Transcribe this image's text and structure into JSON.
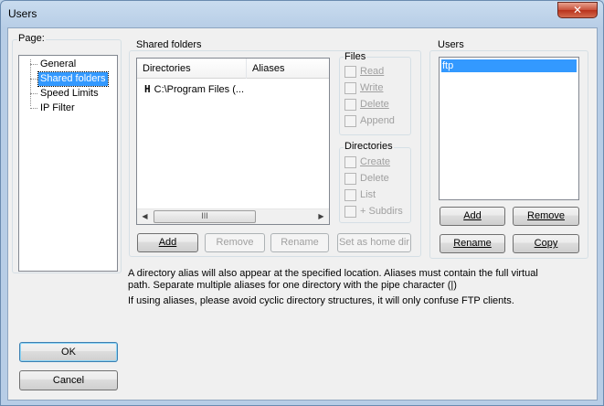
{
  "window": {
    "title": "Users",
    "close_glyph": "✕"
  },
  "page_panel": {
    "label": "Page:",
    "items": [
      "General",
      "Shared folders",
      "Speed Limits",
      "IP Filter"
    ],
    "selected": "Shared folders"
  },
  "shared_folders": {
    "label": "Shared folders",
    "columns": [
      "Directories",
      "Aliases"
    ],
    "rows": [
      {
        "marker": "H",
        "directory": "C:\\Program Files (...",
        "alias": ""
      }
    ],
    "scroll_thumb_glyph": "III",
    "scroll_left_glyph": "◀",
    "scroll_right_glyph": "▶",
    "buttons": {
      "add": "Add",
      "remove": "Remove",
      "rename": "Rename",
      "set_home": "Set as home dir"
    }
  },
  "files_group": {
    "label": "Files",
    "options": [
      "Read",
      "Write",
      "Delete",
      "Append"
    ]
  },
  "directories_group": {
    "label": "Directories",
    "options": [
      "Create",
      "Delete",
      "List",
      "+ Subdirs"
    ]
  },
  "users_panel": {
    "label": "Users",
    "users": [
      "ftp"
    ],
    "selected": "ftp",
    "buttons": {
      "add": "Add",
      "remove": "Remove",
      "rename": "Rename",
      "copy": "Copy"
    }
  },
  "info": {
    "line1": "A directory alias will also appear at the specified location. Aliases must contain the full virtual",
    "line2": "path. Separate multiple aliases for one directory with the pipe character (|)",
    "line3": "If using aliases, please avoid cyclic directory structures, it will only confuse FTP clients."
  },
  "dialog_buttons": {
    "ok": "OK",
    "cancel": "Cancel"
  }
}
